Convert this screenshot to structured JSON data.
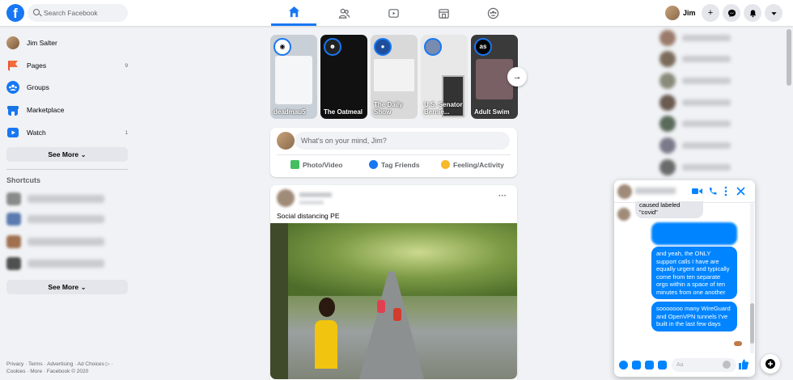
{
  "header": {
    "search_placeholder": "Search Facebook",
    "user_name": "Jim",
    "logo": "f"
  },
  "nav": {
    "tabs": [
      {
        "name": "home",
        "icon": "home-icon",
        "active": true
      },
      {
        "name": "friends",
        "icon": "friends-icon",
        "active": false
      },
      {
        "name": "watch",
        "icon": "watch-icon",
        "active": false
      },
      {
        "name": "marketplace",
        "icon": "marketplace-icon",
        "active": false
      },
      {
        "name": "groups",
        "icon": "groups-icon",
        "active": false
      }
    ],
    "accent": "#1877f2"
  },
  "sidebar": {
    "profile_name": "Jim Salter",
    "items": [
      {
        "label": "Pages",
        "count": "9",
        "color": "#e4572e"
      },
      {
        "label": "Groups",
        "count": "",
        "color": "#1877f2"
      },
      {
        "label": "Marketplace",
        "count": "",
        "color": "#1b74e4"
      },
      {
        "label": "Watch",
        "count": "1",
        "color": "#1877f2"
      }
    ],
    "see_more": "See More",
    "shortcuts_title": "Shortcuts",
    "shortcuts_see_more": "See More",
    "footer": "Privacy · Terms · Advertising · Ad Choices ▷ · Cookies · More · Facebook © 2020"
  },
  "stories": [
    {
      "label": "deadmau5",
      "bg": "#c9cfd6"
    },
    {
      "label": "The Oatmeal",
      "bg": "#111111"
    },
    {
      "label": "The Daily Show",
      "bg": "#d9d9d9"
    },
    {
      "label": "U.S. Senator Bernie...",
      "bg": "#e8e8e8"
    },
    {
      "label": "Adult Swim",
      "bg": "#3a3a3a"
    }
  ],
  "composer": {
    "placeholder": "What's on your mind, Jim?",
    "actions": [
      {
        "label": "Photo/Video",
        "color": "#45bd62"
      },
      {
        "label": "Tag Friends",
        "color": "#1877f2"
      },
      {
        "label": "Feeling/Activity",
        "color": "#f7b928"
      }
    ]
  },
  "post": {
    "text": "Social distancing PE",
    "more": "···"
  },
  "chat": {
    "incoming": "caused labeled \"covid\"",
    "messages": [
      "and yeah, the ONLY support calls I have are equally urgent and typically come from ten separate orgs within a space of ten minutes from one another",
      "sooooooo many WireGuard and OpenVPN tunnels I've built in the last few days"
    ],
    "input_placeholder": "Aa",
    "color": "#0084ff"
  }
}
